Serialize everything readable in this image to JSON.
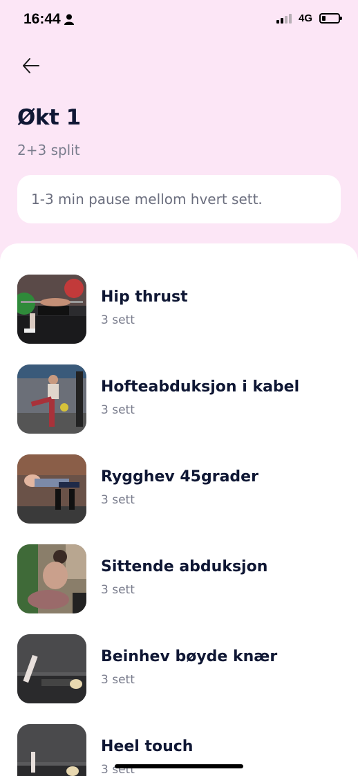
{
  "status_bar": {
    "time": "16:44",
    "network": "4G",
    "icons": [
      "person-icon",
      "signal-icon",
      "battery-icon"
    ]
  },
  "header": {
    "back_icon": "arrow-left-icon",
    "title": "Økt 1",
    "subtitle": "2+3 split",
    "info": "1-3 min pause mellom hvert sett."
  },
  "exercises": [
    {
      "name": "Hip thrust",
      "sets": "3 sett"
    },
    {
      "name": "Hofteabduksjon i kabel",
      "sets": "3 sett"
    },
    {
      "name": "Rygghev 45grader",
      "sets": "3 sett"
    },
    {
      "name": "Sittende abduksjon",
      "sets": "3 sett"
    },
    {
      "name": "Beinhev bøyde knær",
      "sets": "3 sett"
    },
    {
      "name": "Heel touch",
      "sets": "3 sett"
    }
  ],
  "colors": {
    "header_bg": "#fce6f6",
    "title": "#0f1734",
    "muted": "#7a7d8d",
    "card": "#ffffff"
  }
}
